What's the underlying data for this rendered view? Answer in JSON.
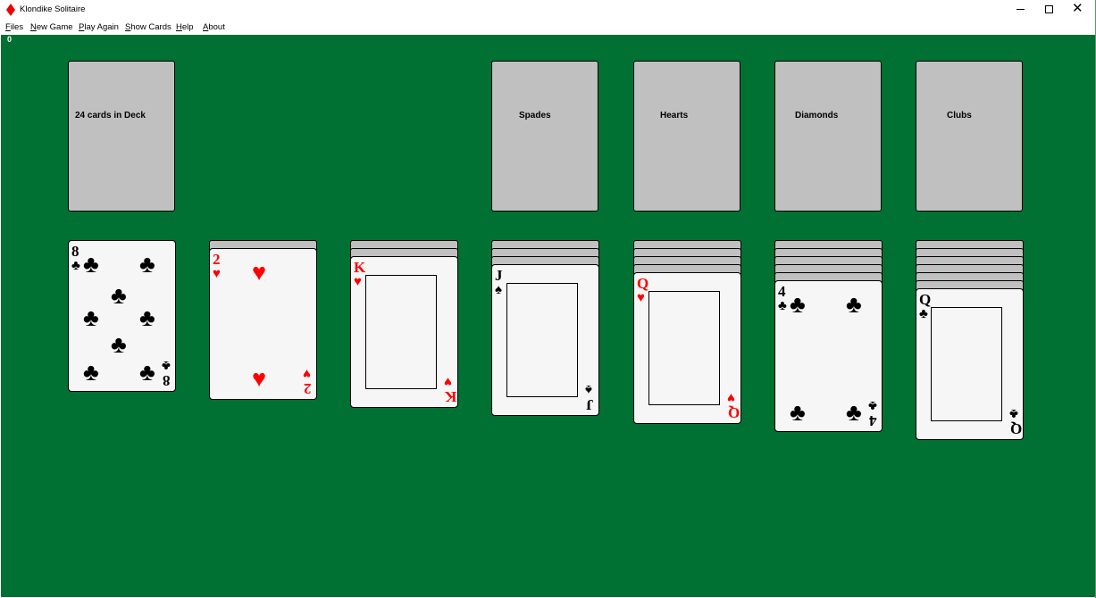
{
  "window": {
    "title": "Klondike Solitaire",
    "icon": "red-diamond-icon"
  },
  "menu": [
    "Files",
    "New Game",
    "Play Again",
    "Show Cards",
    "Help",
    "About"
  ],
  "score": "0",
  "deck": {
    "label": "24 cards in Deck"
  },
  "foundations": [
    "Spades",
    "Hearts",
    "Diamonds",
    "Clubs"
  ],
  "colors": {
    "felt": "#007033",
    "slot": "#c0c0c0",
    "red_suit": "#ff0000"
  },
  "tableau": [
    {
      "face_down": 0,
      "rank": "8",
      "suit": "♣",
      "color": "black"
    },
    {
      "face_down": 1,
      "rank": "2",
      "suit": "♥",
      "color": "red"
    },
    {
      "face_down": 2,
      "rank": "K",
      "suit": "♥",
      "color": "red"
    },
    {
      "face_down": 3,
      "rank": "J",
      "suit": "♠",
      "color": "black"
    },
    {
      "face_down": 4,
      "rank": "Q",
      "suit": "♥",
      "color": "red"
    },
    {
      "face_down": 5,
      "rank": "4",
      "suit": "♣",
      "color": "black"
    },
    {
      "face_down": 6,
      "rank": "Q",
      "suit": "♣",
      "color": "black"
    }
  ]
}
